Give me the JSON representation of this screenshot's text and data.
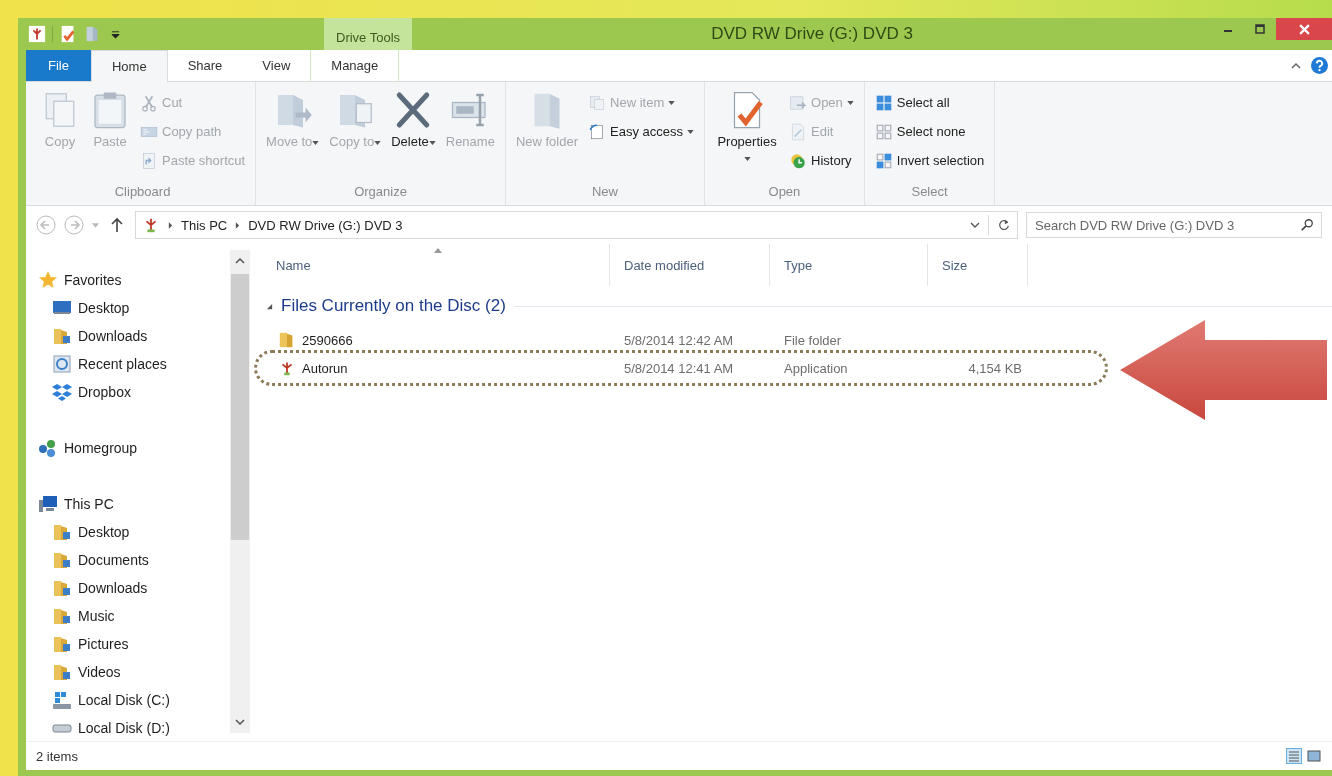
{
  "window": {
    "title": "DVD RW Drive (G:) DVD 3",
    "context_tab": "Drive Tools"
  },
  "ribbon_tabs": [
    {
      "label": "File",
      "kind": "file",
      "selected": false
    },
    {
      "label": "Home",
      "kind": "tab",
      "selected": true
    },
    {
      "label": "Share",
      "kind": "tab",
      "selected": false
    },
    {
      "label": "View",
      "kind": "tab",
      "selected": false
    },
    {
      "label": "Manage",
      "kind": "context",
      "selected": false
    }
  ],
  "ribbon_groups": [
    {
      "label": "Clipboard",
      "items": [
        {
          "label": "Copy",
          "kind": "large",
          "disabled": true,
          "dropdown": false
        },
        {
          "label": "Paste",
          "kind": "large",
          "disabled": true,
          "dropdown": false
        },
        {
          "label": "Cut",
          "kind": "small",
          "disabled": true,
          "dropdown": false
        },
        {
          "label": "Copy path",
          "kind": "small",
          "disabled": true,
          "dropdown": false
        },
        {
          "label": "Paste shortcut",
          "kind": "small",
          "disabled": true,
          "dropdown": false
        }
      ]
    },
    {
      "label": "Organize",
      "items": [
        {
          "label": "Move to",
          "kind": "large",
          "disabled": true,
          "dropdown": true
        },
        {
          "label": "Copy to",
          "kind": "large",
          "disabled": true,
          "dropdown": true
        },
        {
          "label": "Delete",
          "kind": "large",
          "disabled": false,
          "dropdown": true
        },
        {
          "label": "Rename",
          "kind": "large",
          "disabled": true,
          "dropdown": false
        }
      ]
    },
    {
      "label": "New",
      "items": [
        {
          "label": "New folder",
          "kind": "large",
          "disabled": true,
          "dropdown": false
        },
        {
          "label": "New item",
          "kind": "small",
          "disabled": true,
          "dropdown": true
        },
        {
          "label": "Easy access",
          "kind": "small",
          "disabled": false,
          "dropdown": true
        }
      ]
    },
    {
      "label": "Open",
      "items": [
        {
          "label": "Properties",
          "kind": "large",
          "disabled": false,
          "dropdown": true
        },
        {
          "label": "Open",
          "kind": "small",
          "disabled": true,
          "dropdown": true
        },
        {
          "label": "Edit",
          "kind": "small",
          "disabled": true,
          "dropdown": false
        },
        {
          "label": "History",
          "kind": "small",
          "disabled": false,
          "dropdown": false
        }
      ]
    },
    {
      "label": "Select",
      "items": [
        {
          "label": "Select all",
          "kind": "small",
          "disabled": false,
          "dropdown": false
        },
        {
          "label": "Select none",
          "kind": "small",
          "disabled": false,
          "dropdown": false
        },
        {
          "label": "Invert selection",
          "kind": "small",
          "disabled": false,
          "dropdown": false
        }
      ]
    }
  ],
  "address": {
    "breadcrumb": [
      "This PC",
      "DVD RW Drive (G:) DVD 3"
    ],
    "search_placeholder": "Search DVD RW Drive (G:) DVD 3"
  },
  "navigation": [
    {
      "label": "Favorites",
      "kind": "star",
      "children": [
        {
          "label": "Desktop",
          "kind": "screen"
        },
        {
          "label": "Downloads",
          "kind": "folder"
        },
        {
          "label": "Recent places",
          "kind": "recent"
        },
        {
          "label": "Dropbox",
          "kind": "dropbox"
        }
      ]
    },
    {
      "label": "Homegroup",
      "kind": "homegroup"
    },
    {
      "label": "This PC",
      "kind": "computer",
      "children": [
        {
          "label": "Desktop",
          "kind": "folder"
        },
        {
          "label": "Documents",
          "kind": "folder"
        },
        {
          "label": "Downloads",
          "kind": "folder"
        },
        {
          "label": "Music",
          "kind": "folder"
        },
        {
          "label": "Pictures",
          "kind": "folder"
        },
        {
          "label": "Videos",
          "kind": "folder"
        },
        {
          "label": "Local Disk (C:)",
          "kind": "system-drive"
        },
        {
          "label": "Local Disk (D:)",
          "kind": "drive"
        }
      ]
    }
  ],
  "columns": [
    "Name",
    "Date modified",
    "Type",
    "Size"
  ],
  "group": {
    "label": "Files Currently on the Disc (2)",
    "expanded": true
  },
  "rows": [
    {
      "name": "2590666",
      "kind": "folder",
      "date_modified": "5/8/2014 12:42 AM",
      "type": "File folder",
      "highlighted": false
    },
    {
      "name": "Autorun",
      "kind": "application",
      "date_modified": "5/8/2014 12:41 AM",
      "type": "Application",
      "size": "4,154 KB",
      "highlighted": true
    }
  ],
  "status_bar": {
    "item_count": "2 items"
  }
}
